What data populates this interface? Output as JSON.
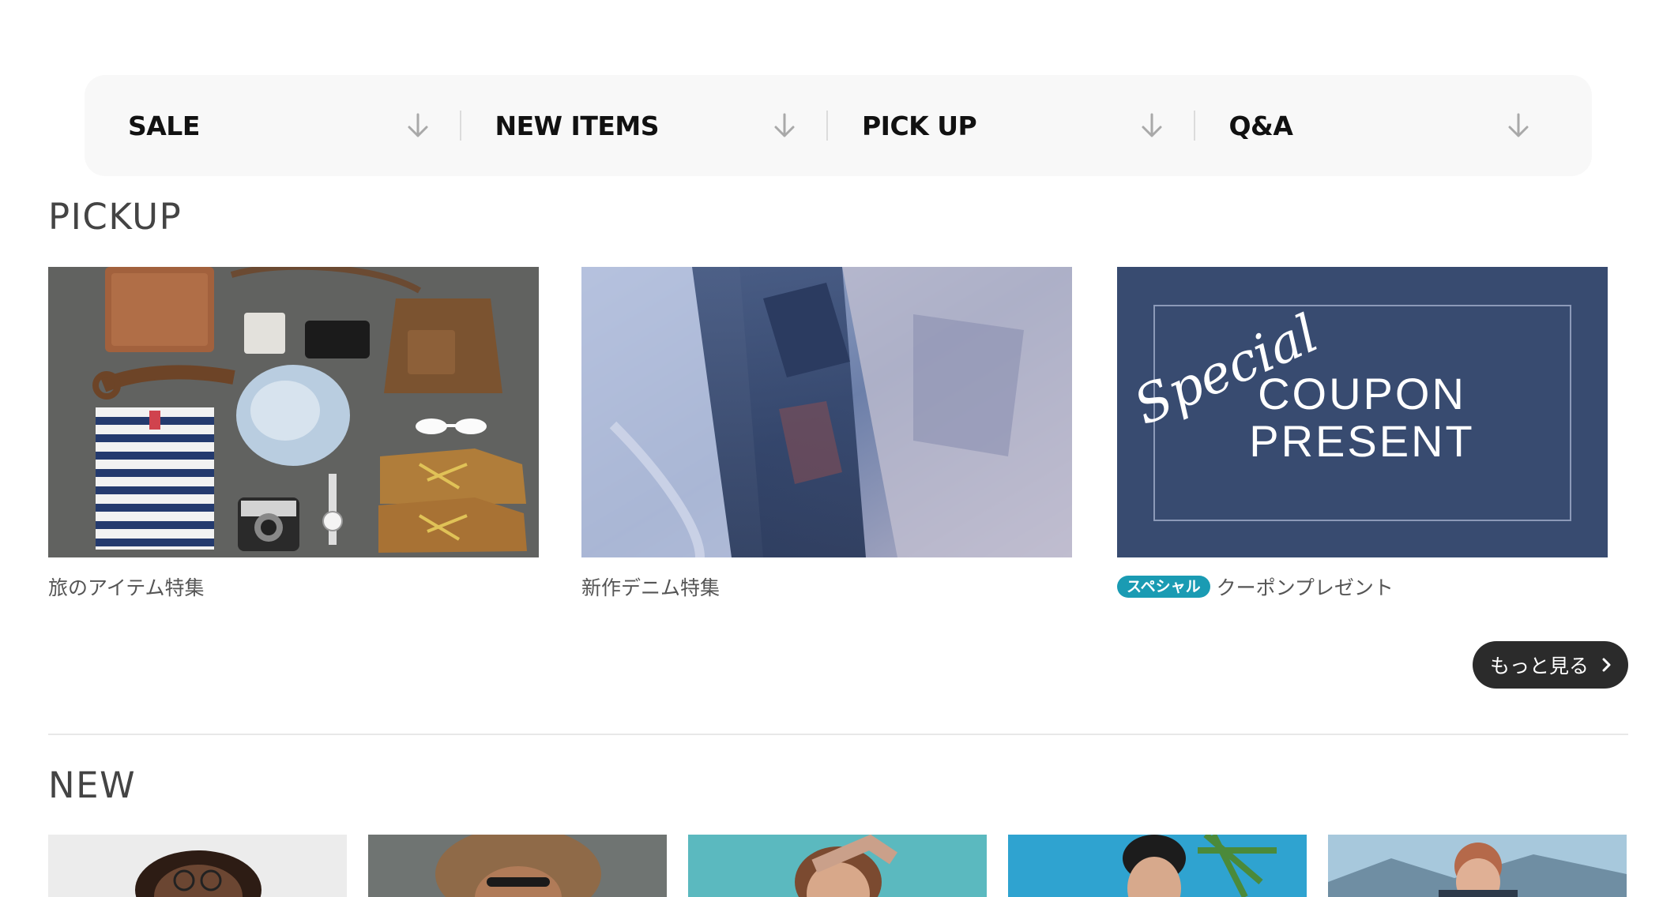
{
  "anchor_nav": {
    "items": [
      {
        "label": "SALE"
      },
      {
        "label": "NEW ITEMS"
      },
      {
        "label": "PICK UP"
      },
      {
        "label": "Q&A"
      }
    ]
  },
  "pickup": {
    "title": "PICKUP",
    "cards": [
      {
        "caption": "旅のアイテム特集"
      },
      {
        "caption": "新作デニム特集"
      },
      {
        "badge": "スペシャル",
        "caption": "クーポンプレゼント",
        "image_text": {
          "script": "Special",
          "line1": "COUPON",
          "line2": "PRESENT"
        }
      }
    ],
    "more_label": "もっと見る"
  },
  "new": {
    "title": "NEW"
  },
  "colors": {
    "nav_bg": "#f8f8f8",
    "badge": "#1a9bb3",
    "button_bg": "#2b2b2b",
    "coupon_bg": "#384b70"
  },
  "icons": {
    "anchor_arrow": "arrow-down-icon",
    "more_chevron": "chevron-right-icon"
  }
}
